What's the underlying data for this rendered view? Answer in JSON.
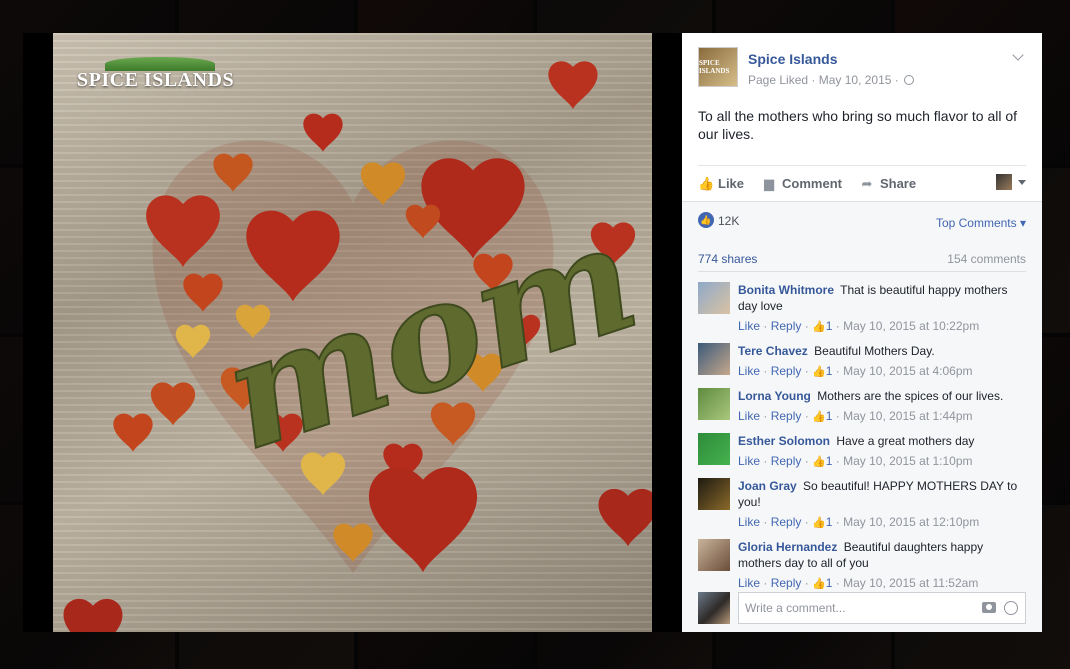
{
  "post": {
    "page_name": "Spice Islands",
    "page_avatar_text": "SPICE ISLANDS",
    "meta": "Page Liked · May 10, 2015 · ",
    "text": "To all the mothers who bring so much flavor to all of our lives.",
    "photo_logo": "SPICE ISLANDS",
    "photo_word": "mom"
  },
  "actions": {
    "like": "Like",
    "comment": "Comment",
    "share": "Share"
  },
  "feedback": {
    "like_count": "12K",
    "sort_label": "Top Comments",
    "shares": "774 shares",
    "comments": "154 comments"
  },
  "comments": [
    {
      "name": "Bonita Whitmore",
      "text": "That is beautiful happy mothers day love",
      "likes": "1",
      "time": "May 10, 2015 at 10:22pm",
      "avatar_colors": [
        "#8fa9c9",
        "#d9c2a3"
      ]
    },
    {
      "name": "Tere Chavez",
      "text": "Beautiful Mothers Day.",
      "likes": "1",
      "time": "May 10, 2015 at 4:06pm",
      "avatar_colors": [
        "#3b5a7a",
        "#c6a88c"
      ]
    },
    {
      "name": "Lorna Young",
      "text": "Mothers are the spices of our lives.",
      "likes": "1",
      "time": "May 10, 2015 at 1:44pm",
      "avatar_colors": [
        "#5e8c3e",
        "#a9c77d"
      ]
    },
    {
      "name": "Esther Solomon",
      "text": "Have a great mothers day",
      "likes": "1",
      "time": "May 10, 2015 at 1:10pm",
      "avatar_colors": [
        "#2e8b3a",
        "#46b24f"
      ]
    },
    {
      "name": "Joan Gray",
      "text": "So beautiful! HAPPY MOTHERS DAY to you!",
      "likes": "1",
      "time": "May 10, 2015 at 12:10pm",
      "avatar_colors": [
        "#1e1a12",
        "#8a6a2a"
      ]
    },
    {
      "name": "Gloria Hernandez",
      "text": "Beautiful daughters happy mothers day to all of you",
      "likes": "1",
      "time": "May 10, 2015 at 11:52am",
      "avatar_colors": [
        "#c9b49a",
        "#6a4d3a"
      ]
    }
  ],
  "comment_labels": {
    "like": "Like",
    "reply": "Reply",
    "sep": " · "
  },
  "composer": {
    "placeholder": "Write a comment..."
  },
  "colors": {
    "link": "#365899",
    "accent": "#4267b2",
    "muted": "#90949c"
  }
}
